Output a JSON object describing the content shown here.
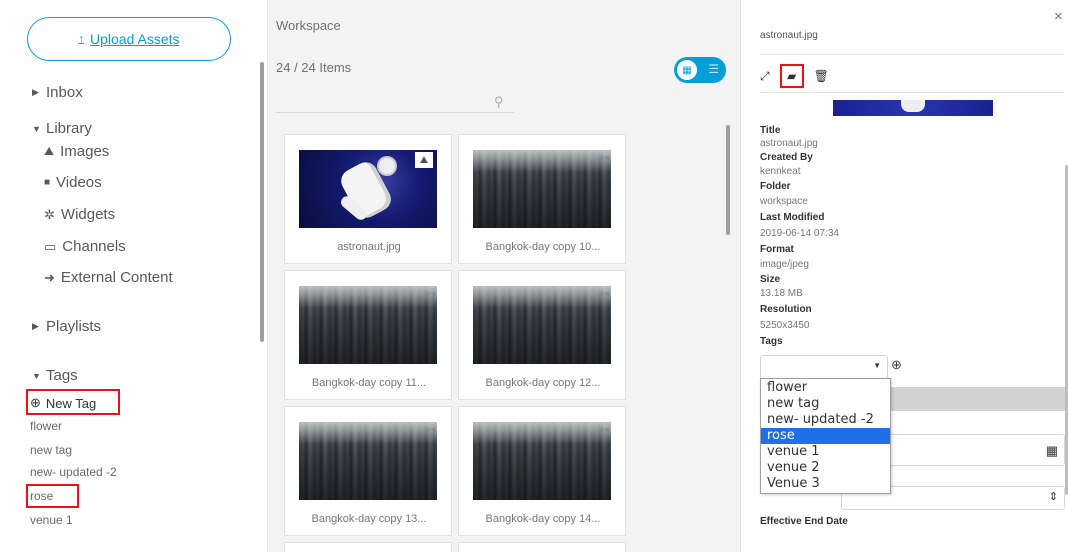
{
  "sidebar": {
    "upload_label": "Upload Assets",
    "upload_arrow": "↑",
    "inbox": "Inbox",
    "library": "Library",
    "library_items": [
      "Images",
      "Videos",
      "Widgets",
      "Channels",
      "External Content"
    ],
    "playlists": "Playlists",
    "tags_heading": "Tags",
    "new_tag": "New Tag",
    "tags": [
      "flower",
      "new tag",
      "new- updated -2",
      "rose",
      "venue 1"
    ]
  },
  "workspace": {
    "title": "Workspace",
    "count": "24 / 24 Items",
    "cards": [
      {
        "label": "astronaut.jpg",
        "kind": "image"
      },
      {
        "label": "Bangkok-day copy 10...",
        "kind": "video"
      },
      {
        "label": "Bangkok-day copy 11...",
        "kind": "video"
      },
      {
        "label": "Bangkok-day copy 12...",
        "kind": "video"
      },
      {
        "label": "Bangkok-day copy 13...",
        "kind": "video"
      },
      {
        "label": "Bangkok-day copy 14...",
        "kind": "video"
      }
    ]
  },
  "detail": {
    "filename": "astronaut.jpg",
    "close": "×",
    "meta": [
      {
        "key": "Title",
        "value": "astronaut.jpg"
      },
      {
        "key": "Created By",
        "value": "kennkeat"
      },
      {
        "key": "Folder",
        "value": "workspace"
      },
      {
        "key": "Last Modified",
        "value": "2019-06-14 07:34"
      },
      {
        "key": "Format",
        "value": "image/jpeg"
      },
      {
        "key": "Size",
        "value": "13.18 MB"
      },
      {
        "key": "Resolution",
        "value": "5250x3450"
      }
    ],
    "tags_label": "Tags",
    "tag_options": [
      "flower",
      "new tag",
      "new- updated -2",
      "rose",
      "venue 1",
      "venue 2",
      "Venue 3"
    ],
    "selected_option": "rose",
    "effective_end": "Effective End Date"
  },
  "colors": {
    "accent": "#049fd9",
    "highlight": "#e11111",
    "selected": "#1e6fe8"
  }
}
